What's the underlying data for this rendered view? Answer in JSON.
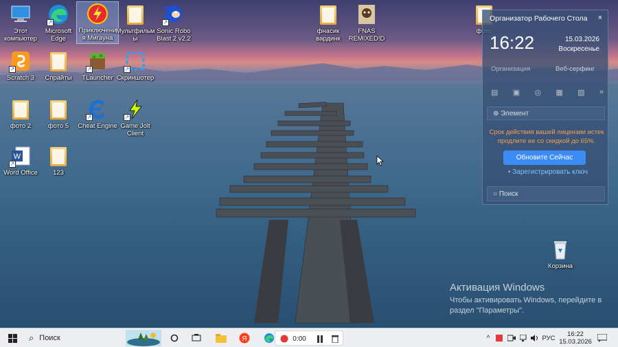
{
  "desktop": {
    "icons": [
      {
        "label": "Этот компьютер",
        "icon": "computer-icon"
      },
      {
        "label": "Microsoft Edge",
        "icon": "edge-icon"
      },
      {
        "label": "Приключения Мигауна",
        "icon": "lightning-app-icon"
      },
      {
        "label": "Мультфильмы",
        "icon": "folder-icon"
      },
      {
        "label": "Sonic Robo Blast 2 v2.2",
        "icon": "sonic-icon"
      },
      {
        "label": "фнасик вардинк",
        "icon": "folder-icon"
      },
      {
        "label": "FNAS REMIXED!D",
        "icon": "game-icon"
      },
      {
        "label": "фото",
        "icon": "folder-icon"
      },
      {
        "label": "Scratch 3",
        "icon": "scratch-icon"
      },
      {
        "label": "Спрайты",
        "icon": "folder-icon"
      },
      {
        "label": "TLauncher",
        "icon": "minecraft-icon"
      },
      {
        "label": "Скриншотер",
        "icon": "screenshot-icon"
      },
      {
        "label": "фото 2",
        "icon": "folder-icon"
      },
      {
        "label": "фото 5",
        "icon": "folder-icon"
      },
      {
        "label": "Cheat Engine",
        "icon": "cheat-engine-icon"
      },
      {
        "label": "Game Jolt Client",
        "icon": "gamejolt-icon"
      },
      {
        "label": "Word Office",
        "icon": "word-icon"
      },
      {
        "label": "123",
        "icon": "folder-icon"
      },
      {
        "label": "Корзина",
        "icon": "recycle-bin-icon"
      }
    ]
  },
  "organizer": {
    "title": "Организатор Рабочего Стола",
    "close": "×",
    "time": "16:22",
    "date": "15.03.2026",
    "weekday": "Воскресенье",
    "shortcut_1": "Организация",
    "shortcut_2": "Веб-серфинг",
    "element_label": "Элемент",
    "license_text": "Срок действия вашей лицензии истек продлите ее со скидкой до 65%.",
    "update_button": "Обновите Сейчас",
    "register_link": "• Зарегистрировать ключ",
    "search_placeholder": "Поиск"
  },
  "activation": {
    "title": "Активация Windows",
    "subtitle": "Чтобы активировать Windows, перейдите в раздел \"Параметры\"."
  },
  "taskbar": {
    "search_label": "Поиск",
    "recorder_time": "0:00",
    "language": "РУС",
    "clock_time": "16:22",
    "clock_date": "15.03.2026"
  },
  "colors": {
    "taskbar_bg": "#eceef2",
    "organizer_accent": "#3d8cf5",
    "license_warning": "#f6a04a",
    "link": "#7fc4ff"
  }
}
